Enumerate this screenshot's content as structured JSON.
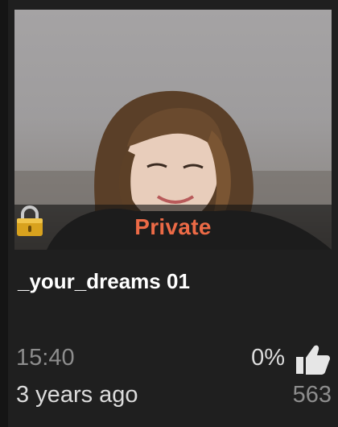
{
  "video": {
    "badge_text": "Private",
    "title": "_your_dreams 01",
    "duration": "15:40",
    "age": "3 years ago",
    "rating": "0%",
    "views": "563"
  },
  "icons": {
    "lock": "lock-icon",
    "thumbs_up": "thumbs-up-icon"
  },
  "colors": {
    "accent": "#ec6a46",
    "card_background": "#1f1f1f",
    "title": "#ffffff",
    "muted": "#8d8d8d"
  }
}
